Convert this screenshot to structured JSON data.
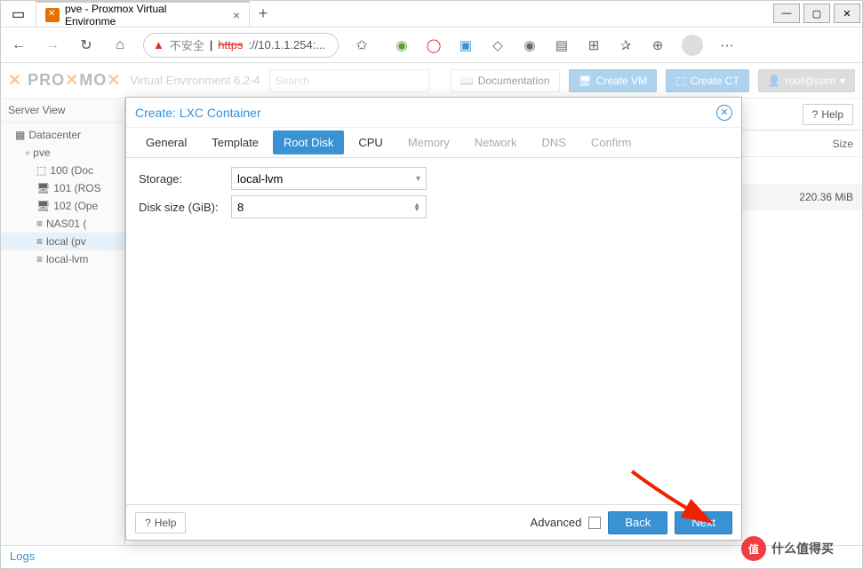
{
  "browser": {
    "tab_title": "pve - Proxmox Virtual Environme",
    "url_warn": "不安全",
    "url_strike": "https",
    "url_text": "://10.1.1.254:..."
  },
  "pve": {
    "logo_text": "PROXMOX",
    "version": "Virtual Environment 6.2-4",
    "search_placeholder": "Search",
    "btn_doc": "Documentation",
    "btn_vm": "Create VM",
    "btn_ct": "Create CT",
    "user": "root@pam"
  },
  "sidebar": {
    "title": "Server View",
    "items": [
      {
        "label": "Datacenter"
      },
      {
        "label": "pve"
      },
      {
        "label": "100 (Doc"
      },
      {
        "label": "101 (ROS"
      },
      {
        "label": "102 (Ope"
      },
      {
        "label": "NAS01 ("
      },
      {
        "label": "local (pv"
      },
      {
        "label": "local-lvm"
      }
    ]
  },
  "content": {
    "help": "Help",
    "col_size": "Size",
    "row_size": "220.36 MiB"
  },
  "logs": "Logs",
  "dialog": {
    "title": "Create: LXC Container",
    "tabs": [
      "General",
      "Template",
      "Root Disk",
      "CPU",
      "Memory",
      "Network",
      "DNS",
      "Confirm"
    ],
    "active_tab": 2,
    "disabled_from": 4,
    "storage_label": "Storage:",
    "storage_value": "local-lvm",
    "disksize_label": "Disk size (GiB):",
    "disksize_value": "8",
    "footer_help": "Help",
    "advanced": "Advanced",
    "back": "Back",
    "next": "Next"
  },
  "watermark": "什么值得买"
}
